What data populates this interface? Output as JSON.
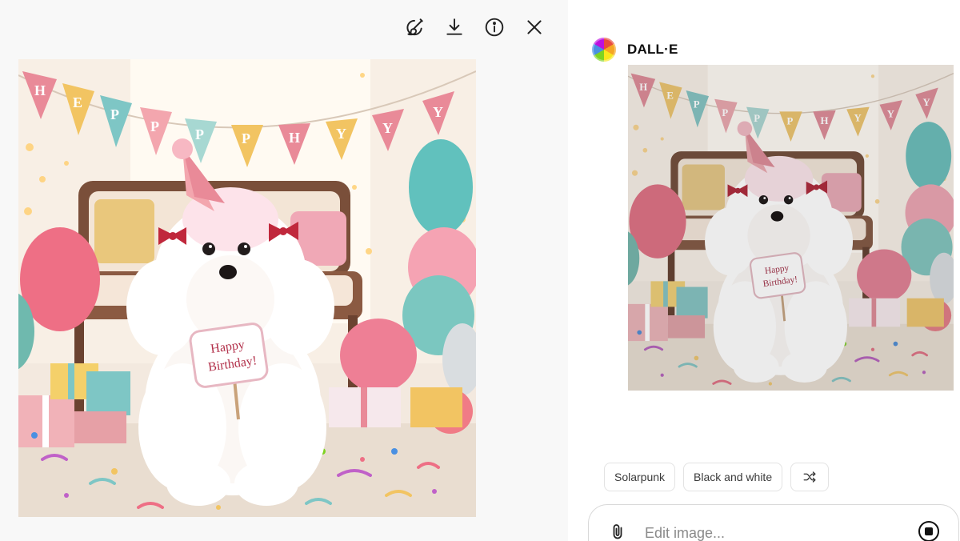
{
  "toolbar": {
    "icons": [
      "edit-brush-icon",
      "download-icon",
      "info-icon",
      "close-icon"
    ]
  },
  "images": {
    "sign_text_line1": "Happy",
    "sign_text_line2": "Birthday!",
    "banner_letters": [
      "H",
      "E",
      "P",
      "P",
      "P",
      "P",
      "H",
      "Y",
      "Y",
      "Y"
    ]
  },
  "chat": {
    "assistant_name": "DALL·E",
    "style_chips": [
      "Solarpunk",
      "Black and white"
    ],
    "shuffle_icon": "shuffle-icon",
    "composer": {
      "placeholder": "Edit image...",
      "attach_icon": "paperclip-icon",
      "stop_icon": "stop-icon"
    }
  },
  "colors": {
    "viewer_bg": "#f8f8f8",
    "text_dark": "#0d0d0d",
    "chip_border": "#e3e3e3"
  }
}
